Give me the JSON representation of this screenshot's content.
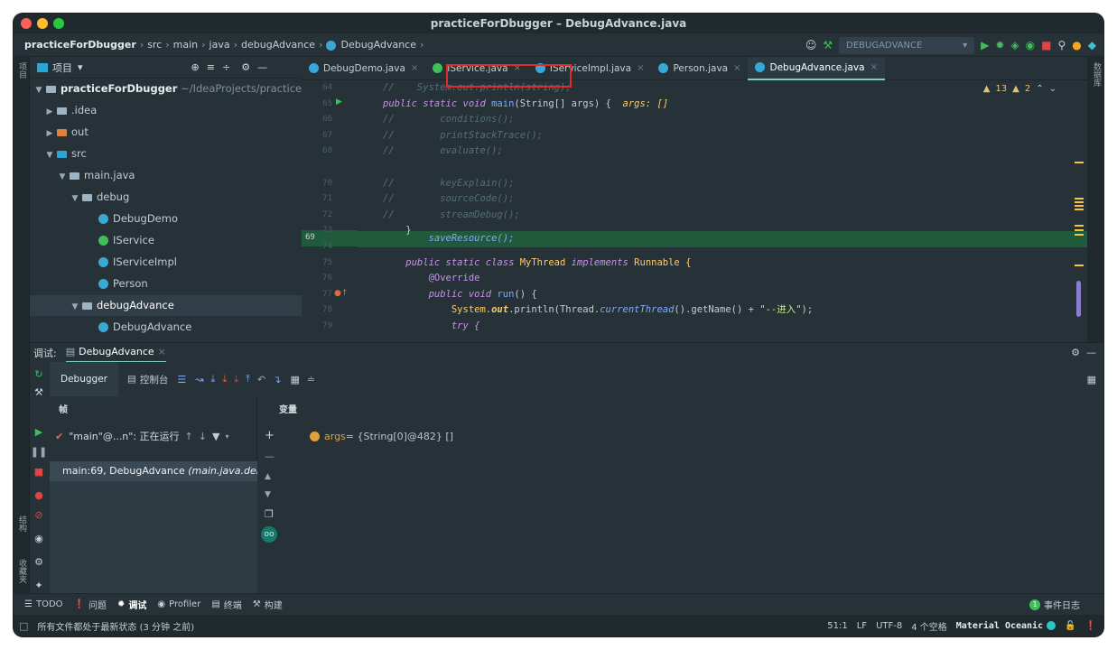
{
  "window": {
    "title": "practiceForDbugger – DebugAdvance.java"
  },
  "breadcrumb": {
    "items": [
      "practiceForDbugger",
      "src",
      "main",
      "java",
      "debugAdvance",
      "DebugAdvance"
    ]
  },
  "run_config": {
    "label": "DEBUGADVANCE"
  },
  "left_strip": {
    "project": "项目",
    "structure": "结构",
    "bookmarks": "收藏夹"
  },
  "right_strip": {
    "database": "数据库"
  },
  "project_panel": {
    "title": "项目",
    "tree": [
      {
        "label": "practiceForDbugger",
        "suffix": "~/IdeaProjects/practiceForDI"
      },
      {
        "label": ".idea"
      },
      {
        "label": "out"
      },
      {
        "label": "src"
      },
      {
        "label": "main.java"
      },
      {
        "label": "debug"
      },
      {
        "label": "DebugDemo"
      },
      {
        "label": "IService"
      },
      {
        "label": "IServiceImpl"
      },
      {
        "label": "Person"
      },
      {
        "label": "debugAdvance"
      },
      {
        "label": "DebugAdvance"
      }
    ]
  },
  "editor": {
    "tabs": [
      {
        "label": "DebugDemo.java"
      },
      {
        "label": "IService.java"
      },
      {
        "label": "IServiceImpl.java"
      },
      {
        "label": "Person.java"
      },
      {
        "label": "DebugAdvance.java"
      }
    ],
    "line_numbers": [
      "64",
      "65",
      "66",
      "67",
      "68",
      "69",
      "70",
      "71",
      "72",
      "73",
      "74",
      "75",
      "76",
      "77",
      "78",
      "79"
    ],
    "inspection": {
      "warnings": "13",
      "weak": "2"
    },
    "code": {
      "l64": "//    System.out.println(string);",
      "l65_a": "public static void ",
      "l65_b": "main",
      "l65_c": "(String[] args) {  ",
      "l65_d": "args: []",
      "l66": "//        conditions();",
      "l67": "//        printStackTrace();",
      "l68": "//        evaluate();",
      "l69": "        saveResource();",
      "l70": "//        keyExplain();",
      "l71": "//        sourceCode();",
      "l72": "//        streamDebug();",
      "l73": "    }",
      "l75_a": "    public static class ",
      "l75_b": "MyThread ",
      "l75_c": "implements ",
      "l75_d": "Runnable {",
      "l76": "        @Override",
      "l77_a": "        public void ",
      "l77_b": "run",
      "l77_c": "() {",
      "l78_a": "            System.",
      "l78_b": "out",
      "l78_c": ".println(Thread.",
      "l78_d": "currentThread",
      "l78_e": "().getName() + ",
      "l78_f": "\"--进入\"",
      "l78_g": ");",
      "l79": "            try {"
    }
  },
  "debug": {
    "label": "调试:",
    "session_tab": "DebugAdvance",
    "tabs": {
      "debugger": "Debugger",
      "console": "控制台"
    },
    "frames_header": "帧",
    "variables_header": "变量",
    "thread": "\"main\"@...n\": 正在运行",
    "frame": "main:69, DebugAdvance ",
    "frame_italic": "(main.java.debu",
    "variable_name": "args",
    "variable_value": " = {String[0]@482} []"
  },
  "bottom_tools": [
    {
      "label": "TODO"
    },
    {
      "label": "问题"
    },
    {
      "label": "调试"
    },
    {
      "label": "Profiler"
    },
    {
      "label": "终端"
    },
    {
      "label": "构建"
    }
  ],
  "event_log": {
    "count": "1",
    "label": "事件日志"
  },
  "status": {
    "message": "所有文件都处于最新状态 (3 分钟 之前)",
    "position": "51:1",
    "line_sep": "LF",
    "encoding": "UTF-8",
    "indent": "4 个空格",
    "theme": "Material Oceanic"
  },
  "colors": {
    "background": "#263238",
    "accent": "#80cbc4",
    "current_line": "#1f5a3d",
    "highlight_box": "#e02b2b"
  }
}
